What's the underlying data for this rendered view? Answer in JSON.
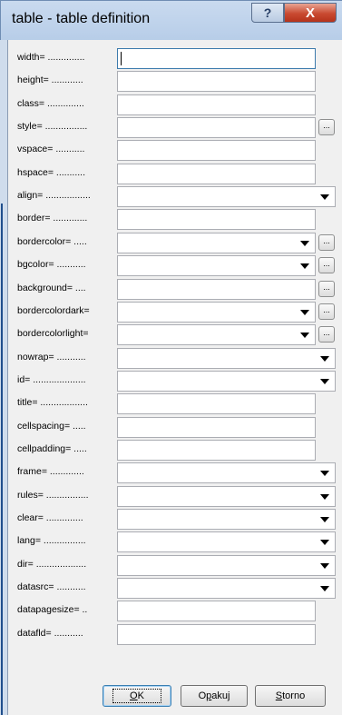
{
  "window": {
    "title": "table - table definition",
    "help_glyph": "?",
    "close_glyph": "X"
  },
  "fields": [
    {
      "label": "width= ..............",
      "kind": "text",
      "focused": true
    },
    {
      "label": "height= ............",
      "kind": "text"
    },
    {
      "label": "class= ..............",
      "kind": "text"
    },
    {
      "label": "style= ................",
      "kind": "text-browse"
    },
    {
      "label": "vspace= ...........",
      "kind": "text"
    },
    {
      "label": "hspace= ...........",
      "kind": "text"
    },
    {
      "label": "align= .................",
      "kind": "select"
    },
    {
      "label": "border= .............",
      "kind": "text"
    },
    {
      "label": "bordercolor= .....",
      "kind": "select-browse"
    },
    {
      "label": "bgcolor= ...........",
      "kind": "select-browse"
    },
    {
      "label": "background= ....",
      "kind": "text-browse"
    },
    {
      "label": "bordercolordark=",
      "kind": "select-browse"
    },
    {
      "label": "bordercolorlight=",
      "kind": "select-browse"
    },
    {
      "label": "nowrap= ...........",
      "kind": "select"
    },
    {
      "label": "id= ....................",
      "kind": "select"
    },
    {
      "label": "title= ..................",
      "kind": "text"
    },
    {
      "label": "cellspacing= .....",
      "kind": "text"
    },
    {
      "label": "cellpadding= .....",
      "kind": "text"
    },
    {
      "label": "frame= .............",
      "kind": "select"
    },
    {
      "label": "rules= ................",
      "kind": "select"
    },
    {
      "label": "clear= ..............",
      "kind": "select"
    },
    {
      "label": "lang= ................",
      "kind": "select"
    },
    {
      "label": "dir= ...................",
      "kind": "select"
    },
    {
      "label": "datasrc= ...........",
      "kind": "select"
    },
    {
      "label": "datapagesize= ..",
      "kind": "text"
    },
    {
      "label": "datafld= ...........",
      "kind": "text"
    }
  ],
  "browse_label": "...",
  "buttons": {
    "ok": {
      "prefix": "",
      "accel": "O",
      "suffix": "K"
    },
    "opakuj": {
      "prefix": "O",
      "accel": "p",
      "suffix": "akuj"
    },
    "storno": {
      "prefix": "",
      "accel": "S",
      "suffix": "torno"
    }
  },
  "icons": {
    "dropdown": "chevron-down-icon",
    "help": "help-icon",
    "close": "close-icon"
  }
}
